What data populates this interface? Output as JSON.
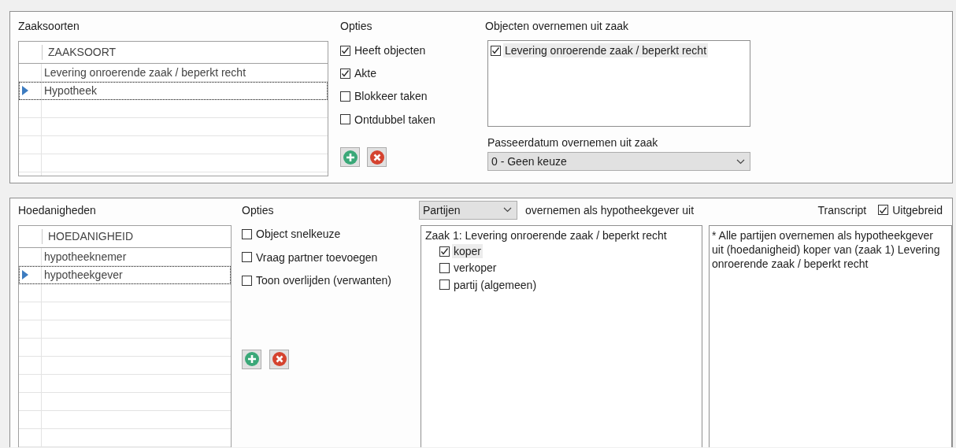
{
  "zaaksoorten": {
    "title": "Zaaksoorten",
    "column": "ZAAKSOORT",
    "rows": [
      {
        "text": "Levering onroerende zaak / beperkt recht",
        "selected": false
      },
      {
        "text": "Hypotheek",
        "selected": true
      }
    ]
  },
  "zaak_opties": {
    "title": "Opties",
    "options": [
      {
        "label": "Heeft objecten",
        "checked": true
      },
      {
        "label": "Akte",
        "checked": true
      },
      {
        "label": "Blokkeer taken",
        "checked": false
      },
      {
        "label": "Ontdubbel taken",
        "checked": false
      }
    ]
  },
  "objecten": {
    "title": "Objecten overnemen uit zaak",
    "items": [
      {
        "label": "Levering onroerende zaak / beperkt recht",
        "checked": true,
        "selected": true
      }
    ]
  },
  "passeerdatum": {
    "label": "Passeerdatum overnemen uit zaak",
    "value": "0 - Geen keuze"
  },
  "hoedanigheden": {
    "title": "Hoedanigheden",
    "column": "HOEDANIGHEID",
    "rows": [
      {
        "text": "hypotheeknemer",
        "selected": false
      },
      {
        "text": "hypotheekgever",
        "selected": true
      }
    ]
  },
  "hoedanigheid_opties": {
    "title": "Opties",
    "options": [
      {
        "label": "Object snelkeuze",
        "checked": false
      },
      {
        "label": "Vraag partner toevoegen",
        "checked": false
      },
      {
        "label": "Toon overlijden (verwanten)",
        "checked": false
      }
    ]
  },
  "partijen": {
    "value": "Partijen",
    "suffix": "overnemen als hypotheekgever uit"
  },
  "transcript": {
    "label": "Transcript",
    "uitgebreid": {
      "label": "Uitgebreid",
      "checked": true
    },
    "text": "* Alle partijen overnemen als hypotheekgever uit (hoedanigheid) koper van (zaak 1) Levering onroerende zaak / beperkt recht"
  },
  "zaken": [
    {
      "label": "Zaak 1: Levering onroerende zaak / beperkt recht",
      "children": [
        {
          "label": "koper",
          "checked": true,
          "selected": true
        },
        {
          "label": "verkoper",
          "checked": false,
          "selected": false
        },
        {
          "label": "partij (algemeen)",
          "checked": false,
          "selected": false
        }
      ]
    }
  ]
}
